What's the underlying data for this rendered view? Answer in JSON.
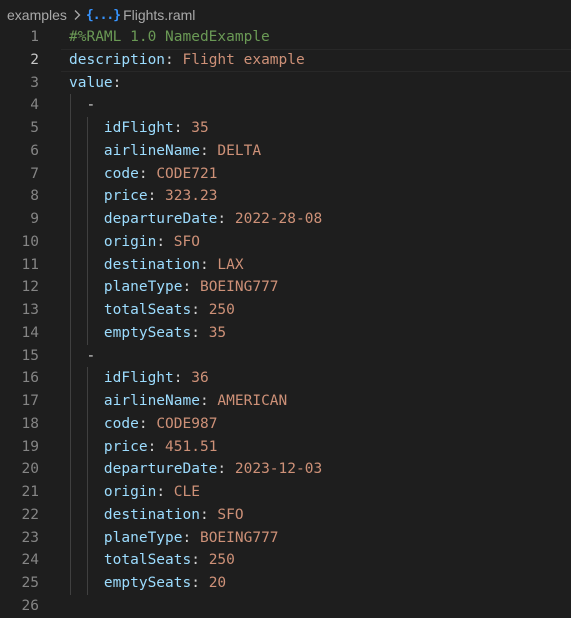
{
  "breadcrumb": {
    "folder": "examples",
    "file_icon": "{...}",
    "file": "Flights.raml"
  },
  "editor": {
    "current_line": 2,
    "lines": [
      {
        "n": "1",
        "indent": 0,
        "parts": [
          {
            "t": "#%RAML 1.0 NamedExample",
            "c": "comment"
          }
        ]
      },
      {
        "n": "2",
        "indent": 0,
        "parts": [
          {
            "t": "description",
            "c": "key2"
          },
          {
            "t": ": ",
            "c": "punct"
          },
          {
            "t": "Flight example",
            "c": "str"
          }
        ]
      },
      {
        "n": "3",
        "indent": 0,
        "parts": [
          {
            "t": "value",
            "c": "key2"
          },
          {
            "t": ":",
            "c": "punct"
          }
        ]
      },
      {
        "n": "4",
        "indent": 1,
        "parts": [
          {
            "t": "  -",
            "c": "dash"
          }
        ]
      },
      {
        "n": "5",
        "indent": 2,
        "parts": [
          {
            "t": "    idFlight",
            "c": "key2"
          },
          {
            "t": ": ",
            "c": "punct"
          },
          {
            "t": "35",
            "c": "str"
          }
        ]
      },
      {
        "n": "6",
        "indent": 2,
        "parts": [
          {
            "t": "    airlineName",
            "c": "key2"
          },
          {
            "t": ": ",
            "c": "punct"
          },
          {
            "t": "DELTA",
            "c": "str"
          }
        ]
      },
      {
        "n": "7",
        "indent": 2,
        "parts": [
          {
            "t": "    code",
            "c": "key2"
          },
          {
            "t": ": ",
            "c": "punct"
          },
          {
            "t": "CODE721",
            "c": "str"
          }
        ]
      },
      {
        "n": "8",
        "indent": 2,
        "parts": [
          {
            "t": "    price",
            "c": "key2"
          },
          {
            "t": ": ",
            "c": "punct"
          },
          {
            "t": "323.23",
            "c": "str"
          }
        ]
      },
      {
        "n": "9",
        "indent": 2,
        "parts": [
          {
            "t": "    departureDate",
            "c": "key2"
          },
          {
            "t": ": ",
            "c": "punct"
          },
          {
            "t": "2022-28-08",
            "c": "str"
          }
        ]
      },
      {
        "n": "10",
        "indent": 2,
        "parts": [
          {
            "t": "    origin",
            "c": "key2"
          },
          {
            "t": ": ",
            "c": "punct"
          },
          {
            "t": "SFO",
            "c": "str"
          }
        ]
      },
      {
        "n": "11",
        "indent": 2,
        "parts": [
          {
            "t": "    destination",
            "c": "key2"
          },
          {
            "t": ": ",
            "c": "punct"
          },
          {
            "t": "LAX",
            "c": "str"
          }
        ]
      },
      {
        "n": "12",
        "indent": 2,
        "parts": [
          {
            "t": "    planeType",
            "c": "key2"
          },
          {
            "t": ": ",
            "c": "punct"
          },
          {
            "t": "BOEING777",
            "c": "str"
          }
        ]
      },
      {
        "n": "13",
        "indent": 2,
        "parts": [
          {
            "t": "    totalSeats",
            "c": "key2"
          },
          {
            "t": ": ",
            "c": "punct"
          },
          {
            "t": "250",
            "c": "str"
          }
        ]
      },
      {
        "n": "14",
        "indent": 2,
        "parts": [
          {
            "t": "    emptySeats",
            "c": "key2"
          },
          {
            "t": ": ",
            "c": "punct"
          },
          {
            "t": "35",
            "c": "str"
          }
        ]
      },
      {
        "n": "15",
        "indent": 1,
        "parts": [
          {
            "t": "  -",
            "c": "dash"
          }
        ]
      },
      {
        "n": "16",
        "indent": 2,
        "parts": [
          {
            "t": "    idFlight",
            "c": "key2"
          },
          {
            "t": ": ",
            "c": "punct"
          },
          {
            "t": "36",
            "c": "str"
          }
        ]
      },
      {
        "n": "17",
        "indent": 2,
        "parts": [
          {
            "t": "    airlineName",
            "c": "key2"
          },
          {
            "t": ": ",
            "c": "punct"
          },
          {
            "t": "AMERICAN",
            "c": "str"
          }
        ]
      },
      {
        "n": "18",
        "indent": 2,
        "parts": [
          {
            "t": "    code",
            "c": "key2"
          },
          {
            "t": ": ",
            "c": "punct"
          },
          {
            "t": "CODE987",
            "c": "str"
          }
        ]
      },
      {
        "n": "19",
        "indent": 2,
        "parts": [
          {
            "t": "    price",
            "c": "key2"
          },
          {
            "t": ": ",
            "c": "punct"
          },
          {
            "t": "451.51",
            "c": "str"
          }
        ]
      },
      {
        "n": "20",
        "indent": 2,
        "parts": [
          {
            "t": "    departureDate",
            "c": "key2"
          },
          {
            "t": ": ",
            "c": "punct"
          },
          {
            "t": "2023-12-03",
            "c": "str"
          }
        ]
      },
      {
        "n": "21",
        "indent": 2,
        "parts": [
          {
            "t": "    origin",
            "c": "key2"
          },
          {
            "t": ": ",
            "c": "punct"
          },
          {
            "t": "CLE",
            "c": "str"
          }
        ]
      },
      {
        "n": "22",
        "indent": 2,
        "parts": [
          {
            "t": "    destination",
            "c": "key2"
          },
          {
            "t": ": ",
            "c": "punct"
          },
          {
            "t": "SFO",
            "c": "str"
          }
        ]
      },
      {
        "n": "23",
        "indent": 2,
        "parts": [
          {
            "t": "    planeType",
            "c": "key2"
          },
          {
            "t": ": ",
            "c": "punct"
          },
          {
            "t": "BOEING777",
            "c": "str"
          }
        ]
      },
      {
        "n": "24",
        "indent": 2,
        "parts": [
          {
            "t": "    totalSeats",
            "c": "key2"
          },
          {
            "t": ": ",
            "c": "punct"
          },
          {
            "t": "250",
            "c": "str"
          }
        ]
      },
      {
        "n": "25",
        "indent": 2,
        "parts": [
          {
            "t": "    emptySeats",
            "c": "key2"
          },
          {
            "t": ": ",
            "c": "punct"
          },
          {
            "t": "20",
            "c": "str"
          }
        ]
      },
      {
        "n": "26",
        "indent": 0,
        "parts": []
      }
    ]
  },
  "colors": {
    "background": "#1e1e1e",
    "comment": "#6a9955",
    "key": "#9cdcfe",
    "string": "#ce9178",
    "line_number": "#858585",
    "line_number_active": "#c6c6c6",
    "indent_guide": "#404040"
  }
}
